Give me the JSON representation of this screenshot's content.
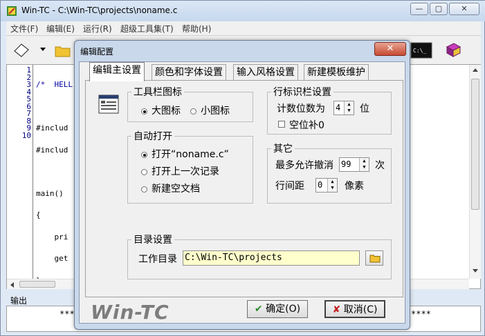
{
  "window": {
    "title": "Win-TC - C:\\Win-TC\\projects\\noname.c",
    "minimize": "—",
    "maximize": "▢",
    "close": "✕"
  },
  "menu": [
    "文件(F)",
    "编辑(E)",
    "运行(R)",
    "超级工具集(T)",
    "帮助(H)"
  ],
  "toolbar_icons": [
    "new-file-icon",
    "open-folder-icon",
    "console-icon",
    "help-book-icon"
  ],
  "editor": {
    "line_numbers": [
      "1",
      "2",
      "3",
      "4",
      "5",
      "6",
      "7",
      "8",
      "9",
      "10"
    ],
    "lines": [
      "/*  HELL",
      "",
      "#includ",
      "#includ",
      "",
      "main()",
      "{",
      "    pri",
      "    get",
      "}"
    ]
  },
  "output": {
    "label": "输出",
    "left_text": "***",
    "right_text": "****"
  },
  "dialog": {
    "title": "编辑配置",
    "close": "✕",
    "tabs": [
      "编辑主设置",
      "颜色和字体设置",
      "输入风格设置",
      "新建模板维护"
    ],
    "toolbar_group": {
      "title": "工具栏图标",
      "options": [
        "大图标",
        "小图标"
      ],
      "selected": 0
    },
    "autoopen_group": {
      "title": "自动打开",
      "options": [
        "打开“noname.c”",
        "打开上一次记录",
        "新建空文档"
      ],
      "selected": 0
    },
    "lineid_group": {
      "title": "行标识栏设置",
      "digits_label": "计数位数为",
      "digits_value": "4",
      "digits_unit": "位",
      "zero_pad_label": "空位补0",
      "zero_pad_checked": false
    },
    "other_group": {
      "title": "其它",
      "undo_label": "最多允许撤消",
      "undo_value": "99",
      "undo_unit": "次",
      "spacing_label": "行间距",
      "spacing_value": "0",
      "spacing_unit": "像素"
    },
    "dir_group": {
      "title": "目录设置",
      "workdir_label": "工作目录",
      "workdir_value": "C:\\Win-TC\\projects"
    },
    "logo": "Win-TC",
    "ok_label": "确定(O)",
    "cancel_label": "取消(C)"
  }
}
